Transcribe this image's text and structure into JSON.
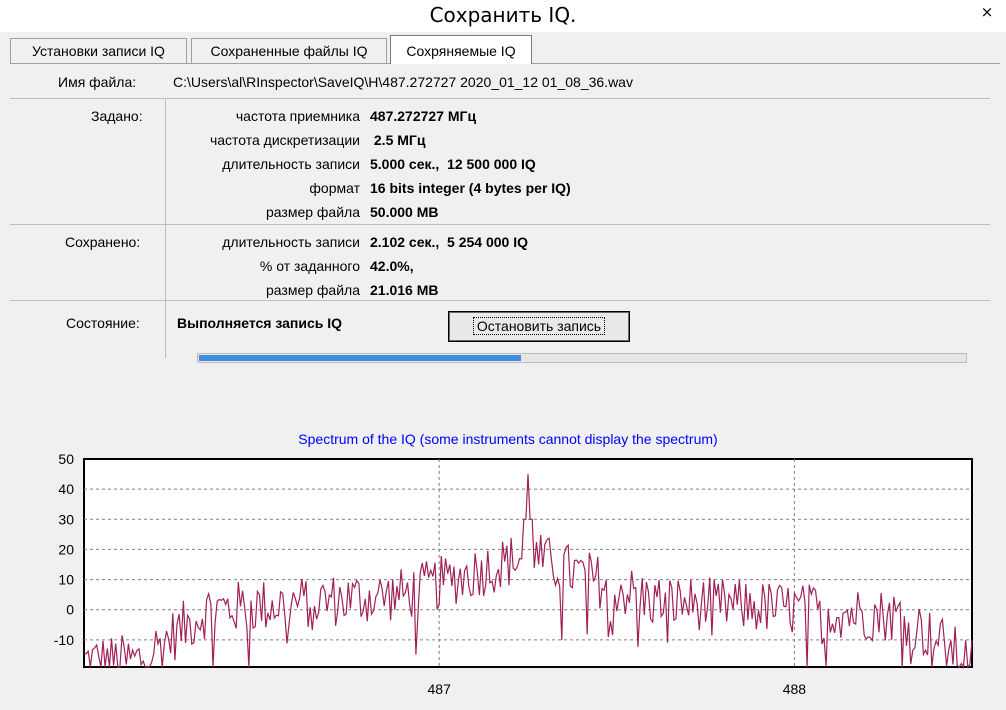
{
  "window": {
    "title": "Сохранить IQ.",
    "close_glyph": "×"
  },
  "tabs": [
    {
      "label": "Установки записи IQ",
      "active": false
    },
    {
      "label": "Сохраненные файлы IQ",
      "active": false
    },
    {
      "label": "Сохряняемые IQ",
      "active": true
    }
  ],
  "file": {
    "label": "Имя файла:",
    "path": "C:\\Users\\al\\RInspector\\SaveIQ\\H\\487.272727 2020_01_12  01_08_36.wav"
  },
  "set": {
    "label": "Задано:",
    "rows": [
      {
        "k": "частота приемника",
        "v": "487.272727 МГц"
      },
      {
        "k": "частота дискретизации",
        "v": " 2.5 МГц"
      },
      {
        "k": "длительность записи",
        "v": "5.000 сек.,  12 500 000 IQ"
      },
      {
        "k": "формат",
        "v": "16 bits integer (4 bytes per IQ)"
      },
      {
        "k": "размер файла",
        "v": "50.000 MB"
      }
    ]
  },
  "saved": {
    "label": "Сохранено:",
    "rows": [
      {
        "k": "длительность записи",
        "v": "2.102 сек.,  5 254 000 IQ"
      },
      {
        "k": "% от заданного",
        "v": "42.0%,"
      },
      {
        "k": "размер файла",
        "v": "21.016 MB"
      }
    ]
  },
  "status": {
    "label": "Состояние:",
    "value": "Выполняется запись IQ",
    "stop_label": "Остановить запись"
  },
  "progress": {
    "fraction": 0.42,
    "color": "#3c8ee0"
  },
  "chart_data": {
    "type": "line",
    "title": "Spectrum of the IQ (some instruments cannot display the spectrum)",
    "title_color": "#0000ff",
    "line_color": "#a0205a",
    "xlim": [
      486.0,
      488.5
    ],
    "ylim": [
      -19,
      50
    ],
    "yticks": [
      50,
      40,
      30,
      20,
      10,
      0,
      -10
    ],
    "xticks": [
      487,
      488
    ],
    "grid": true,
    "peak_x": 487.25,
    "peak_y": 45
  }
}
